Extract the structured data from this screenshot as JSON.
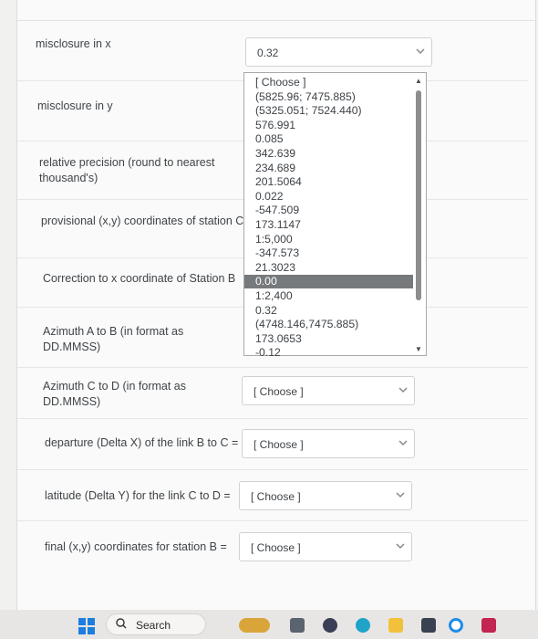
{
  "questions": [
    {
      "label": "misclosure in x",
      "value": "0.32"
    },
    {
      "label": "misclosure in y",
      "value": ""
    },
    {
      "label": "relative precision (round to nearest thousand's)",
      "value": ""
    },
    {
      "label": "provisional (x,y) coordinates of station C",
      "value": ""
    },
    {
      "label": "Correction to x coordinate of Station B",
      "value": ""
    },
    {
      "label": "Azimuth A to B (in format as DD.MMSS)",
      "value": ""
    },
    {
      "label": "Azimuth C to D (in format as DD.MMSS)",
      "value": "[ Choose ]"
    },
    {
      "label": "departure (Delta X) of the link B to C =",
      "value": "[ Choose ]"
    },
    {
      "label": "latitude (Delta Y) for the link C to D =",
      "value": "[ Choose ]"
    },
    {
      "label": "final (x,y) coordinates for station B =",
      "value": "[ Choose ]"
    }
  ],
  "dropdown": {
    "options": [
      "[ Choose ]",
      "(5825.96; 7475.885)",
      "(5325.051; 7524.440)",
      "576.991",
      "0.085",
      "342.639",
      "234.689",
      "201.5064",
      "0.022",
      "-547.509",
      "173.1147",
      "1:5,000",
      "-347.573",
      "21.3023",
      "0.00",
      "1:2,400",
      "0.32",
      "(4748.146,7475.885)",
      "173.0653",
      "-0.12"
    ],
    "selected_index": 14
  },
  "taskbar": {
    "search_label": "Search",
    "colors": {
      "start": "#1e7de0",
      "bg": "#e8e6e4"
    }
  }
}
